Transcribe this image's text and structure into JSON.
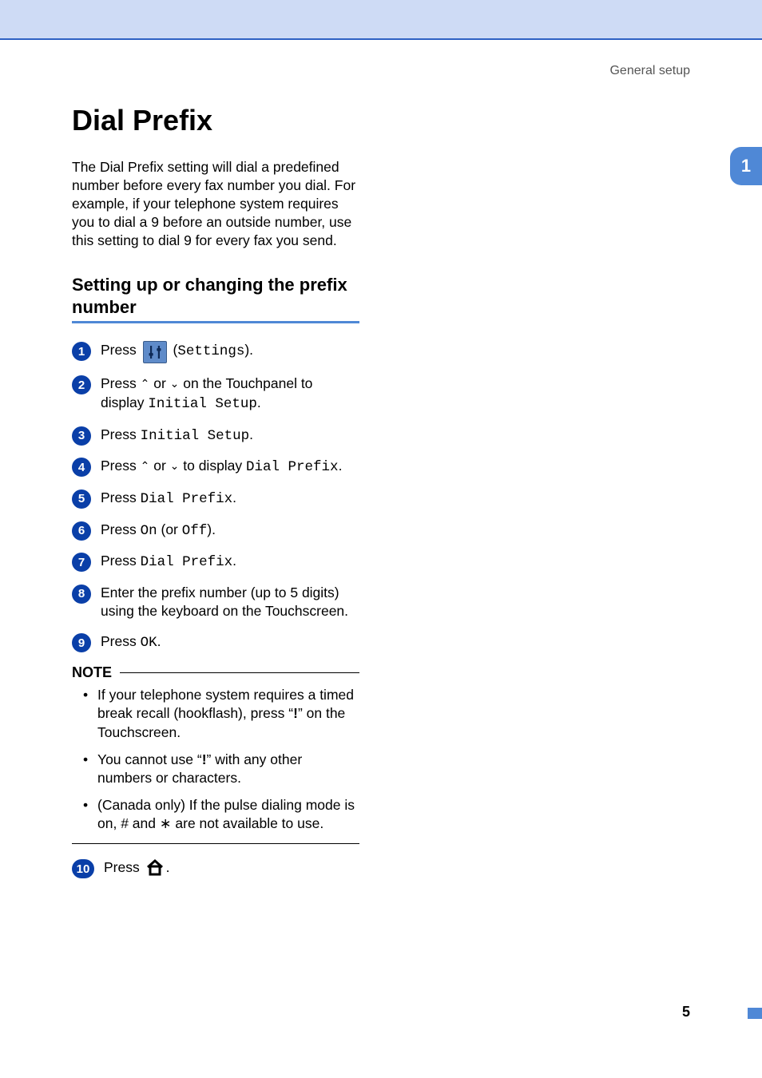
{
  "header": {
    "section_label": "General setup",
    "chapter_number": "1"
  },
  "title": "Dial Prefix",
  "intro": "The Dial Prefix setting will dial a predefined number before every fax number you dial. For example, if your telephone system requires you to dial a 9 before an outside number, use this setting to dial 9 for every fax you send.",
  "subheading": "Setting up or changing the prefix number",
  "steps": {
    "s1": {
      "press": "Press ",
      "settings_label": "Settings"
    },
    "s2": {
      "a": "Press ",
      "b": " or ",
      "c": " on the Touchpanel to display ",
      "menu": "Initial Setup",
      "d": "."
    },
    "s3": {
      "a": "Press ",
      "menu": "Initial Setup",
      "b": "."
    },
    "s4": {
      "a": "Press ",
      "b": " or ",
      "c": " to display ",
      "menu": "Dial Prefix",
      "d": "."
    },
    "s5": {
      "a": "Press ",
      "menu": "Dial Prefix",
      "b": "."
    },
    "s6": {
      "a": "Press ",
      "on": "On",
      "mid": " (or ",
      "off": "Off",
      "end": ")."
    },
    "s7": {
      "a": "Press ",
      "menu": "Dial Prefix",
      "b": "."
    },
    "s8": "Enter the prefix number (up to 5 digits) using the keyboard on the Touchscreen.",
    "s9": {
      "a": "Press ",
      "ok": "OK",
      "b": "."
    },
    "s10": {
      "a": "Press ",
      "b": "."
    }
  },
  "note": {
    "label": "NOTE",
    "items": [
      {
        "a": "If your telephone system requires a timed break recall (hookflash), press “",
        "sym": "!",
        "b": "” on the Touchscreen."
      },
      {
        "a": "You cannot use “",
        "sym": "!",
        "b": "” with any other numbers or characters."
      },
      {
        "a": "(Canada only) If the pulse dialing mode is on, # and ",
        "star": "∗",
        "b": " are not available to use."
      }
    ]
  },
  "footer": {
    "page_number": "5"
  }
}
